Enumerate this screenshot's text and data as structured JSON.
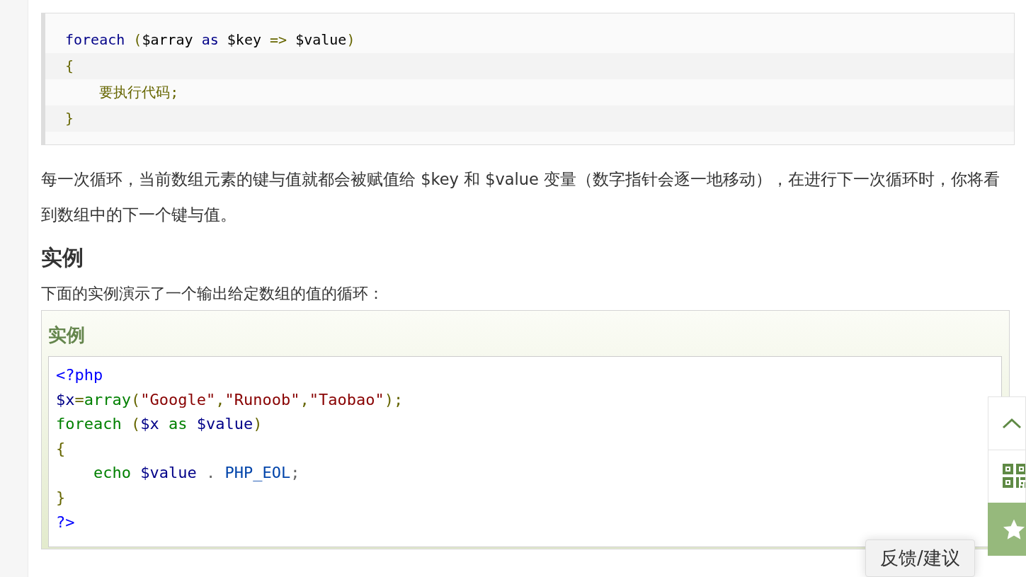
{
  "syntax_code": {
    "lines": [
      {
        "tokens": [
          {
            "text": "foreach",
            "kind": "kw"
          },
          {
            "text": " (",
            "kind": "pun"
          },
          {
            "text": "$array ",
            "kind": "plain"
          },
          {
            "text": "as",
            "kind": "kw"
          },
          {
            "text": " $key ",
            "kind": "plain"
          },
          {
            "text": "=>",
            "kind": "pun"
          },
          {
            "text": " $value",
            "kind": "plain"
          },
          {
            "text": ")",
            "kind": "pun"
          }
        ]
      },
      {
        "tokens": [
          {
            "text": "{",
            "kind": "pun"
          }
        ]
      },
      {
        "tokens": [
          {
            "text": "    要执行代码;",
            "kind": "pun"
          }
        ]
      },
      {
        "tokens": [
          {
            "text": "}",
            "kind": "pun"
          }
        ]
      }
    ]
  },
  "description": "每一次循环，当前数组元素的键与值就都会被赋值给 $key 和 $value 变量（数字指针会逐一地移动），在进行下一次循环时，你将看到数组中的下一个键与值。",
  "heading": "实例",
  "intro": "下面的实例演示了一个输出给定数组的值的循环：",
  "example": {
    "title": "实例",
    "lines": [
      {
        "tokens": [
          {
            "text": "<?php",
            "kind": "tag"
          }
        ]
      },
      {
        "tokens": [
          {
            "text": "$x",
            "kind": "var"
          },
          {
            "text": "=",
            "kind": "pun"
          },
          {
            "text": "array",
            "kind": "fn"
          },
          {
            "text": "(",
            "kind": "pun"
          },
          {
            "text": "\"Google\"",
            "kind": "str"
          },
          {
            "text": ",",
            "kind": "pun"
          },
          {
            "text": "\"Runoob\"",
            "kind": "str"
          },
          {
            "text": ",",
            "kind": "pun"
          },
          {
            "text": "\"Taobao\"",
            "kind": "str"
          },
          {
            "text": ");",
            "kind": "pun"
          }
        ]
      },
      {
        "tokens": [
          {
            "text": "foreach",
            "kind": "fn"
          },
          {
            "text": " (",
            "kind": "pun"
          },
          {
            "text": "$x",
            "kind": "var"
          },
          {
            "text": " as",
            "kind": "fn"
          },
          {
            "text": " $value",
            "kind": "var"
          },
          {
            "text": ")",
            "kind": "pun"
          }
        ]
      },
      {
        "tokens": [
          {
            "text": "{",
            "kind": "pun"
          }
        ]
      },
      {
        "tokens": [
          {
            "text": "    echo",
            "kind": "fn"
          },
          {
            "text": " $value",
            "kind": "var"
          },
          {
            "text": " . ",
            "kind": "op"
          },
          {
            "text": "PHP_EOL",
            "kind": "lit"
          },
          {
            "text": ";",
            "kind": "op"
          }
        ]
      },
      {
        "tokens": [
          {
            "text": "}",
            "kind": "pun"
          }
        ]
      },
      {
        "tokens": [
          {
            "text": "?>",
            "kind": "tag"
          }
        ]
      }
    ]
  },
  "side_toolbar": {
    "buttons": [
      {
        "kind": "top"
      },
      {
        "kind": "qr"
      },
      {
        "kind": "star"
      }
    ]
  },
  "feedback_button": {
    "label": "反馈/建议"
  }
}
